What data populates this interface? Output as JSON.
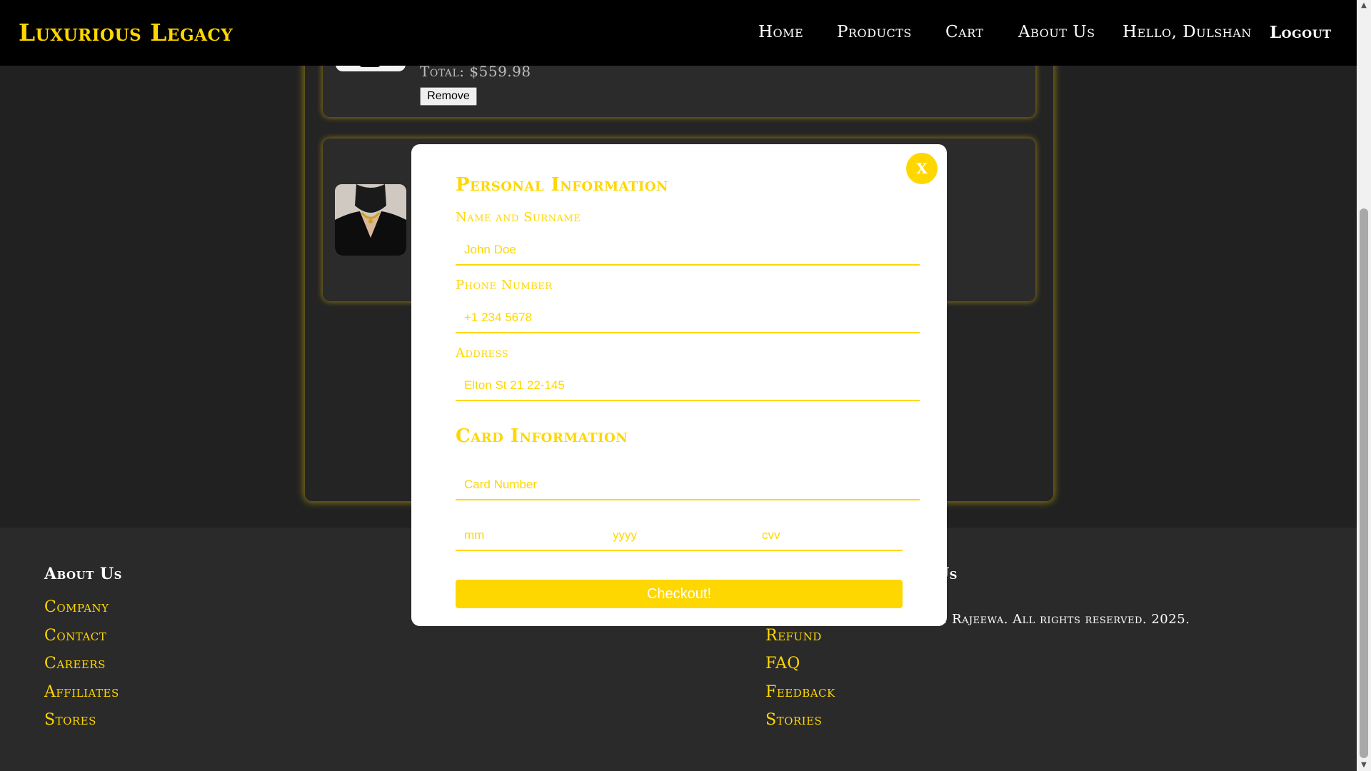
{
  "navbar": {
    "brand": "Luxurious Legacy",
    "links": {
      "home": "Home",
      "products": "Products",
      "cart": "Cart",
      "about": "About Us"
    },
    "greeting": "Hello, Dulshan",
    "logout": "Logout"
  },
  "cart": {
    "items": [
      {
        "total": "Total: $559.98",
        "remove_label": "Remove"
      }
    ]
  },
  "footer": {
    "about_heading": "About Us",
    "about_links": [
      "Company",
      "Contact",
      "Careers",
      "Affiliates",
      "Stores"
    ],
    "follow_heading_partial": "Us",
    "support_links": [
      "Refund",
      "FAQ",
      "Feedback",
      "Stories"
    ],
    "copyright_partial": "an Rajeewa. All rights reserved. 2025."
  },
  "modal": {
    "close_label": "X",
    "personal_title": "Personal Information",
    "name_label": "Name and Surname",
    "name_placeholder": "John Doe",
    "phone_label": "Phone Number",
    "phone_placeholder": "+1 234 5678",
    "address_label": "Address",
    "address_placeholder": "Elton St 21 22-145",
    "card_title": "Card Information",
    "card_number_placeholder": "Card Number",
    "month_placeholder": "mm",
    "year_placeholder": "yyyy",
    "cvv_placeholder": "cvv",
    "checkout_label": "Checkout!"
  },
  "colors": {
    "accent": "#FFD700",
    "navbar_bg": "#000000",
    "page_bg": "#212121",
    "modal_bg": "#FFFFFF"
  }
}
